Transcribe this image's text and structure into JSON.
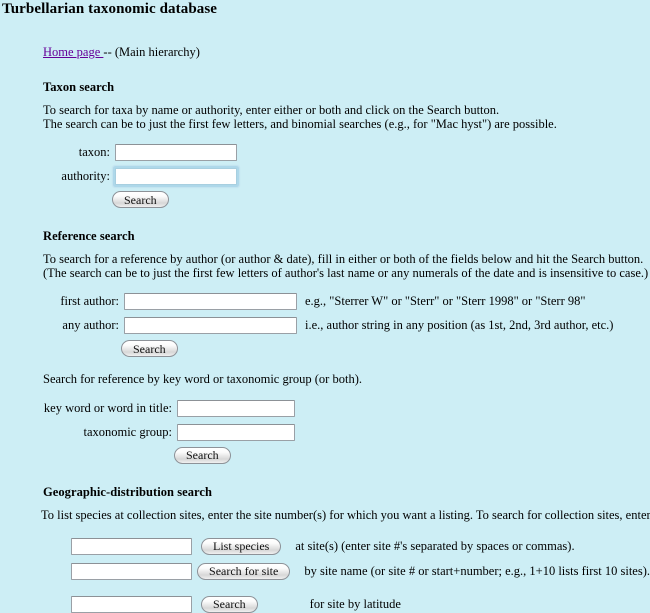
{
  "page": {
    "title": "Turbellarian taxonomic database"
  },
  "nav": {
    "home_link": "Home page ",
    "suffix": "-- (Main hierarchy)"
  },
  "taxon_search": {
    "heading": "Taxon search",
    "intro_line1": "To search for taxa by name or authority, enter either or both and click on the Search button.",
    "intro_line2": "The search can be to just the first few letters, and binomial searches (e.g., for \"Mac hyst\") are possible.",
    "taxon_label": "taxon:",
    "taxon_value": "",
    "authority_label": "authority:",
    "authority_value": "",
    "search_button": "Search"
  },
  "reference_search": {
    "heading": "Reference search",
    "intro_line1": "To search for a reference by author (or author & date), fill in either or both of the fields below and hit the Search button.",
    "intro_line2": "(The search can be to just the first few letters of author's last name or any numerals of the date and is insensitive to case.)",
    "first_author_label": "first author:",
    "first_author_value": "",
    "first_author_hint": "e.g., \"Sterrer W\" or \"Sterr\" or \"Sterr 1998\" or \"Sterr 98\"",
    "any_author_label": "any author:",
    "any_author_value": "",
    "any_author_hint": "i.e., author string in any position (as 1st, 2nd, 3rd author, etc.)",
    "search_button": "Search",
    "keyword_intro": "Search for reference by key word or taxonomic group (or both).",
    "keyword_label": "key word or word in title:",
    "keyword_value": "",
    "taxgroup_label": "taxonomic group:",
    "taxgroup_value": "",
    "keyword_search_button": "Search"
  },
  "geographic_search": {
    "heading": "Geographic-distribution search",
    "intro": "To list species at collection sites, enter the site number(s) for which you want a listing. To search for collection sites, enter either a site name or site number.",
    "rows": [
      {
        "value": "",
        "button": "List species",
        "hint": "at site(s) (enter site #'s separated by spaces or commas)."
      },
      {
        "value": "",
        "button": "Search for site",
        "hint": "by site name (or site # or start+number; e.g., 1+10 lists first 10 sites)."
      },
      {
        "value": "",
        "button": "Search",
        "hint": "for site by latitude"
      }
    ]
  },
  "colors": {
    "background": "#cdeef5",
    "link": "#660099",
    "text": "#000000",
    "focus_ring": "#aed8ea"
  }
}
